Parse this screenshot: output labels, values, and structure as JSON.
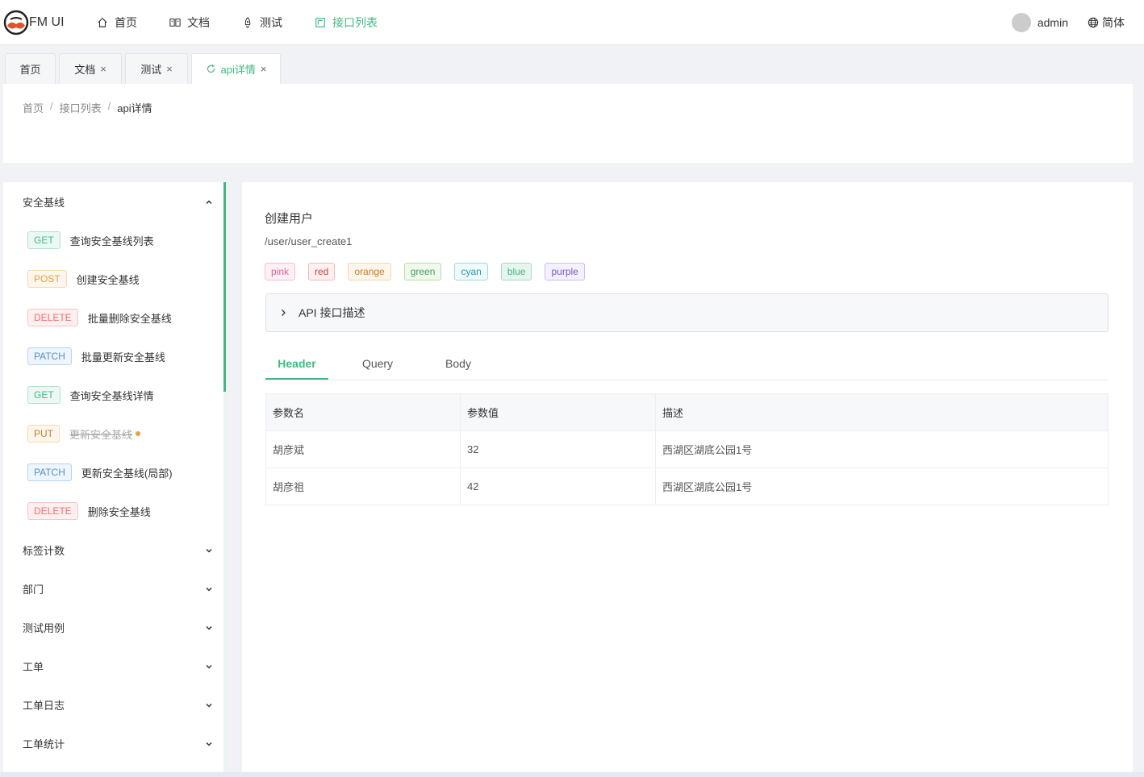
{
  "app": {
    "logo_text": "FM UI"
  },
  "topnav": [
    {
      "label": "首页",
      "icon": "home-icon"
    },
    {
      "label": "文档",
      "icon": "book-icon"
    },
    {
      "label": "测试",
      "icon": "rocket-icon"
    },
    {
      "label": "接口列表",
      "icon": "window-icon",
      "active": true
    }
  ],
  "user": {
    "name": "admin"
  },
  "lang": {
    "label": "简体"
  },
  "tabs": [
    {
      "label": "首页"
    },
    {
      "label": "文档",
      "close": "×"
    },
    {
      "label": "测试",
      "close": "×"
    },
    {
      "label": "api详情",
      "close": "×",
      "active": true
    }
  ],
  "breadcrumb": {
    "items": [
      "首页",
      "接口列表",
      "api详情"
    ],
    "sep": "/"
  },
  "sidebar": {
    "group_open": "安全基线",
    "apis": [
      {
        "method": "GET",
        "label": "查询安全基线列表"
      },
      {
        "method": "POST",
        "label": "创建安全基线"
      },
      {
        "method": "DELETE",
        "label": "批量删除安全基线"
      },
      {
        "method": "PATCH",
        "label": "批量更新安全基线"
      },
      {
        "method": "GET",
        "label": "查询安全基线详情"
      },
      {
        "method": "PUT",
        "label": "更新安全基线",
        "deprecated": true
      },
      {
        "method": "PATCH",
        "label": "更新安全基线(局部)"
      },
      {
        "method": "DELETE",
        "label": "删除安全基线"
      }
    ],
    "groups_closed": [
      "标签计数",
      "部门",
      "测试用例",
      "工单",
      "工单日志",
      "工单统计"
    ]
  },
  "main": {
    "title": "创建用户",
    "path": "/user/user_create1",
    "tags": [
      {
        "label": "pink",
        "color": "#e0629a",
        "bg": "#fdf0f5",
        "border": "#f5bfd6"
      },
      {
        "label": "red",
        "color": "#d0404a",
        "bg": "#fef0f0",
        "border": "#f5b8bb"
      },
      {
        "label": "orange",
        "color": "#d07a20",
        "bg": "#fdf6ec",
        "border": "#f5d6a8"
      },
      {
        "label": "green",
        "color": "#41a363",
        "bg": "#f0f9eb",
        "border": "#b6e2a0"
      },
      {
        "label": "cyan",
        "color": "#2a9aa8",
        "bg": "#eefafb",
        "border": "#9fdbe2"
      },
      {
        "label": "blue",
        "color": "#41b883",
        "bg": "#e6f5ee",
        "border": "#a6dcc2"
      },
      {
        "label": "purple",
        "color": "#7a5ac7",
        "bg": "#f4f0fd",
        "border": "#cdbff0"
      }
    ],
    "collapse_label": "API 接口描述",
    "param_tabs": [
      {
        "label": "Header",
        "active": true
      },
      {
        "label": "Query"
      },
      {
        "label": "Body"
      }
    ],
    "table": {
      "headers": [
        "参数名",
        "参数值",
        "描述"
      ],
      "rows": [
        [
          "胡彦斌",
          "32",
          "西湖区湖底公园1号"
        ],
        [
          "胡彦祖",
          "42",
          "西湖区湖底公园1号"
        ]
      ]
    }
  },
  "colors": {
    "accent": "#41b883"
  }
}
